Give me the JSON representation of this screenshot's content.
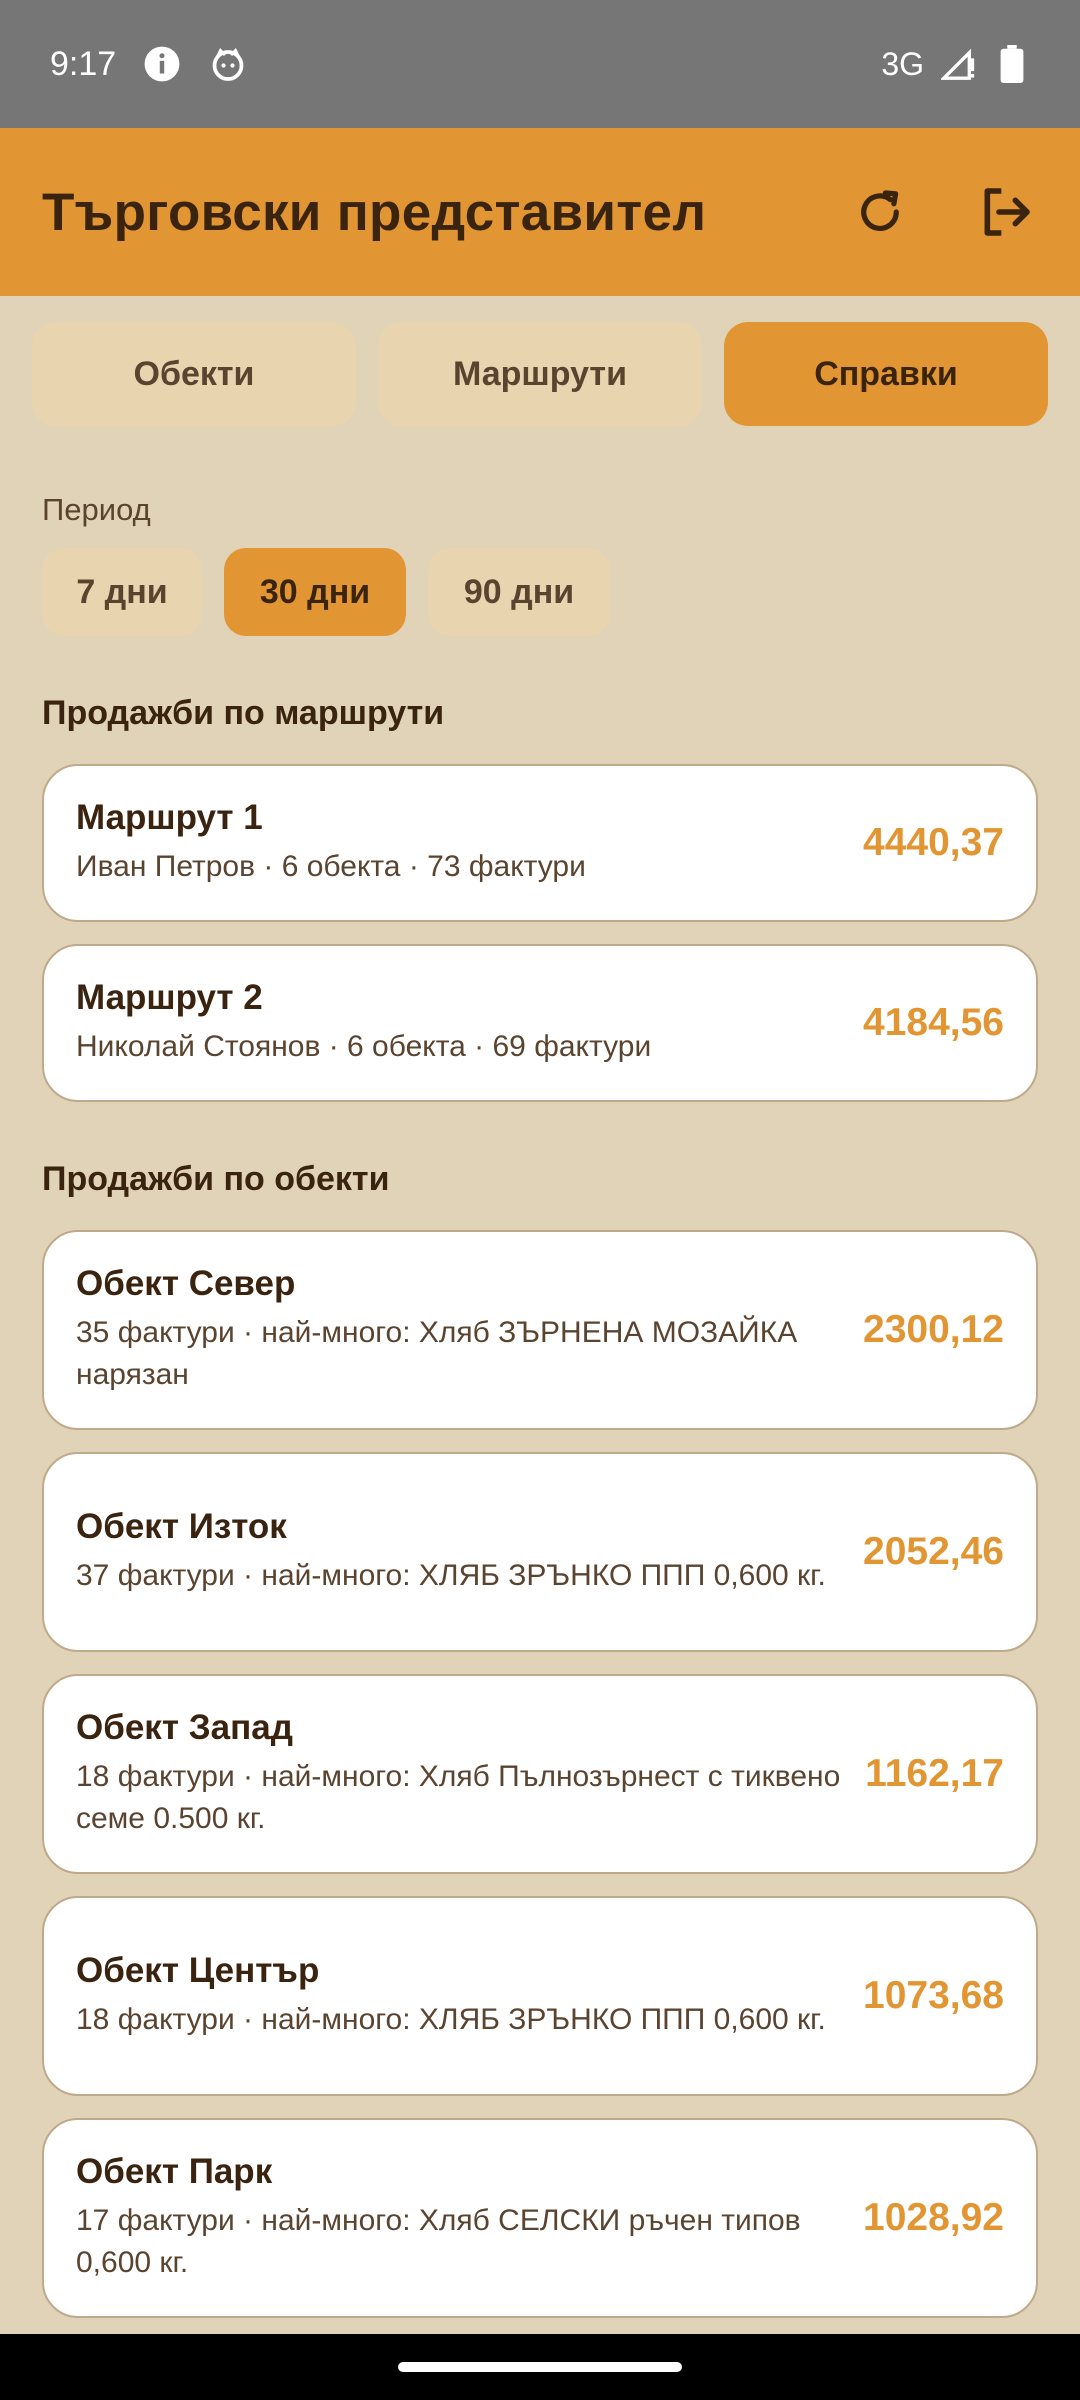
{
  "status_bar": {
    "time": "9:17",
    "network": "3G",
    "icons": [
      "info-icon",
      "cat-icon",
      "signal-icon",
      "battery-icon"
    ]
  },
  "app_bar": {
    "title": "Търговски представител",
    "refresh_icon": "refresh-icon",
    "logout_icon": "logout-icon"
  },
  "tabs": [
    {
      "label": "Обекти",
      "active": false
    },
    {
      "label": "Маршрути",
      "active": false
    },
    {
      "label": "Справки",
      "active": true
    }
  ],
  "period": {
    "label": "Период",
    "options": [
      {
        "label": "7 дни",
        "active": false
      },
      {
        "label": "30 дни",
        "active": true
      },
      {
        "label": "90 дни",
        "active": false
      }
    ]
  },
  "routes_section": {
    "title": "Продажби по маршрути",
    "items": [
      {
        "title": "Маршрут 1",
        "subtitle": "Иван Петров · 6 обекта · 73 фактури",
        "value": "4440,37"
      },
      {
        "title": "Маршрут 2",
        "subtitle": "Николай Стоянов · 6 обекта · 69 фактури",
        "value": "4184,56"
      }
    ]
  },
  "objects_section": {
    "title": "Продажби по обекти",
    "items": [
      {
        "title": "Обект Север",
        "subtitle": "35 фактури · най-много: Хляб ЗЪРНЕНА МОЗАЙКА нарязан",
        "value": "2300,12"
      },
      {
        "title": "Обект Изток",
        "subtitle": "37 фактури · най-много: ХЛЯБ ЗРЪНКО ППП 0,600 кг.",
        "value": "2052,46"
      },
      {
        "title": "Обект Запад",
        "subtitle": "18 фактури · най-много: Хляб Пълнозърнест с тиквено семе 0.500 кг.",
        "value": "1162,17"
      },
      {
        "title": "Обект Център",
        "subtitle": "18 фактури · най-много: ХЛЯБ ЗРЪНКО ППП 0,600 кг.",
        "value": "1073,68"
      },
      {
        "title": "Обект Парк",
        "subtitle": "17 фактури · най-много: Хляб СЕЛСКИ ръчен типов 0,600 кг.",
        "value": "1028,92"
      }
    ]
  },
  "colors": {
    "accent": "#E29633",
    "background": "#E1D3B8",
    "chip_inactive": "#E8D4AE",
    "text_dark": "#3A2410"
  }
}
